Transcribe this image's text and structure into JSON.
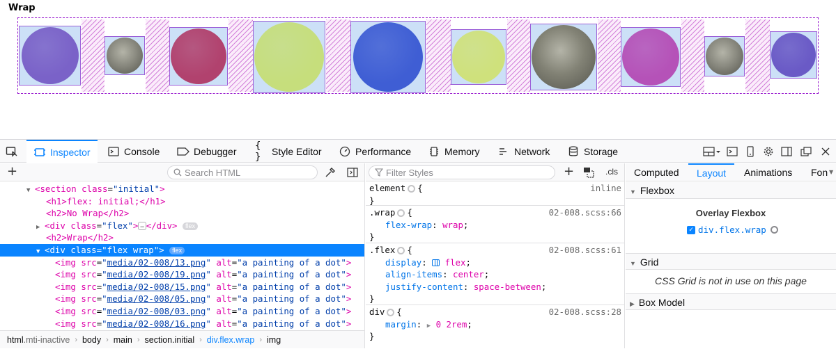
{
  "page": {
    "heading": "Wrap",
    "dots": [
      {
        "color": "#7a62c8",
        "kind": "paint"
      },
      {
        "color": "#8a8a80",
        "kind": "coin"
      },
      {
        "color": "#b1426e",
        "kind": "paint"
      },
      {
        "color": "#c6de7c",
        "kind": "paint"
      },
      {
        "color": "#3f5ed4",
        "kind": "paint"
      },
      {
        "color": "#cfe17c",
        "kind": "paint"
      },
      {
        "color": "#828275",
        "kind": "coin"
      },
      {
        "color": "#b552b8",
        "kind": "paint"
      },
      {
        "color": "#8a8a80",
        "kind": "coin"
      },
      {
        "color": "#6a5ac6",
        "kind": "paint"
      }
    ]
  },
  "toolbar": {
    "pick_icon": "element-picker-icon",
    "tabs": [
      {
        "label": "Inspector",
        "icon": "inspector-icon"
      },
      {
        "label": "Console",
        "icon": "console-icon"
      },
      {
        "label": "Debugger",
        "icon": "debugger-icon"
      },
      {
        "label": "Style Editor",
        "icon": "braces-icon"
      },
      {
        "label": "Performance",
        "icon": "gauge-icon"
      },
      {
        "label": "Memory",
        "icon": "chip-icon"
      },
      {
        "label": "Network",
        "icon": "network-icon"
      },
      {
        "label": "Storage",
        "icon": "database-icon"
      }
    ]
  },
  "markup": {
    "search_placeholder": "Search HTML",
    "lines": {
      "l0_tag": "<section",
      "l0_an": "class",
      "l0_av": "\"initial\"",
      "l0_end": ">",
      "l1": "<h1>flex: initial;</h1>",
      "l2": "<h2>No Wrap</h2>",
      "l3_open": "<div",
      "l3_an": "class",
      "l3_av": "\"flex\"",
      "l3_close": "></div>",
      "l4": "<h2>Wrap</h2>",
      "l5_open": "<div",
      "l5_an": "class",
      "l5_av": "\"flex wrap\"",
      "l5_close": ">",
      "badge": "flex",
      "img_src_attr": "src",
      "img_alt_attr": "alt",
      "img_alt": "\"a painting of a dot\"",
      "imgs": [
        "media/02-008/13.png",
        "media/02-008/19.png",
        "media/02-008/15.png",
        "media/02-008/05.png",
        "media/02-008/03.png",
        "media/02-008/16.png"
      ]
    }
  },
  "breadcrumbs": [
    "html",
    ".mti-inactive",
    "body",
    "main",
    "section.initial",
    "div.flex.wrap",
    "img"
  ],
  "rules_panel": {
    "filter_placeholder": "Filter Styles",
    "cls": ".cls",
    "rules": [
      {
        "selector": "element",
        "source": "inline",
        "decls": []
      },
      {
        "selector": ".wrap",
        "source": "02-008.scss:66",
        "decls": [
          {
            "prop": "flex-wrap",
            "value": "wrap"
          }
        ]
      },
      {
        "selector": ".flex",
        "source": "02-008.scss:61",
        "decls": [
          {
            "prop": "display",
            "value": "flex"
          },
          {
            "prop": "align-items",
            "value": "center"
          },
          {
            "prop": "justify-content",
            "value": "space-between"
          }
        ]
      },
      {
        "selector": "div",
        "source": "02-008.scss:28",
        "decls": [
          {
            "prop": "margin",
            "value": "0 2rem"
          }
        ]
      }
    ]
  },
  "layout_panel": {
    "tabs": [
      "Computed",
      "Layout",
      "Animations",
      "Fon"
    ],
    "flexbox_header": "Flexbox",
    "overlay_title": "Overlay Flexbox",
    "overlay_item": "div.flex.wrap",
    "grid_header": "Grid",
    "grid_message": "CSS Grid is not in use on this page",
    "boxmodel_header": "Box Model"
  }
}
